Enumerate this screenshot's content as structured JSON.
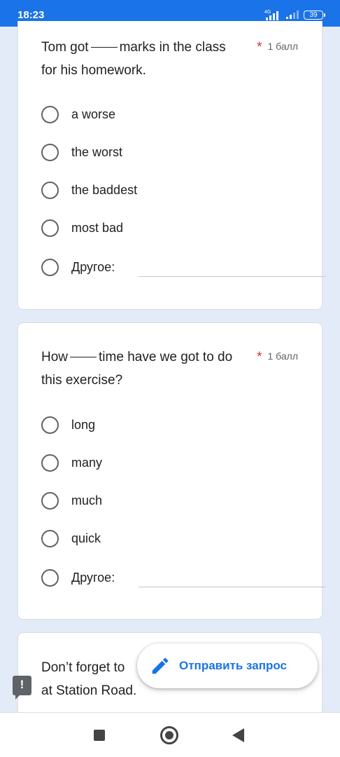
{
  "status_bar": {
    "time": "18:23",
    "network": "4G",
    "battery": "39"
  },
  "questions": [
    {
      "text_before": "Tom got",
      "text_after": "marks in the class for his homework.",
      "points": "1 балл",
      "required_mark": "*",
      "options": [
        "a worse",
        "the worst",
        "the baddest",
        "most bad",
        "Другое:"
      ]
    },
    {
      "text_before": "How",
      "text_after": "time have we got to do this exercise?",
      "points": "1 балл",
      "required_mark": "*",
      "options": [
        "long",
        "many",
        "much",
        "quick",
        "Другое:"
      ]
    },
    {
      "text_line1": "Don’t forget to",
      "text_line2": "at Station Road."
    }
  ],
  "fab": {
    "label": "Отправить запрос",
    "icon": "pencil-icon"
  },
  "alert": {
    "symbol": "!",
    "icon": "feedback-icon"
  },
  "nav": {
    "icons": [
      "recents-square-icon",
      "home-circle-icon",
      "back-triangle-icon"
    ]
  },
  "colors": {
    "brand": "#1a73e8",
    "required": "#d93025"
  }
}
